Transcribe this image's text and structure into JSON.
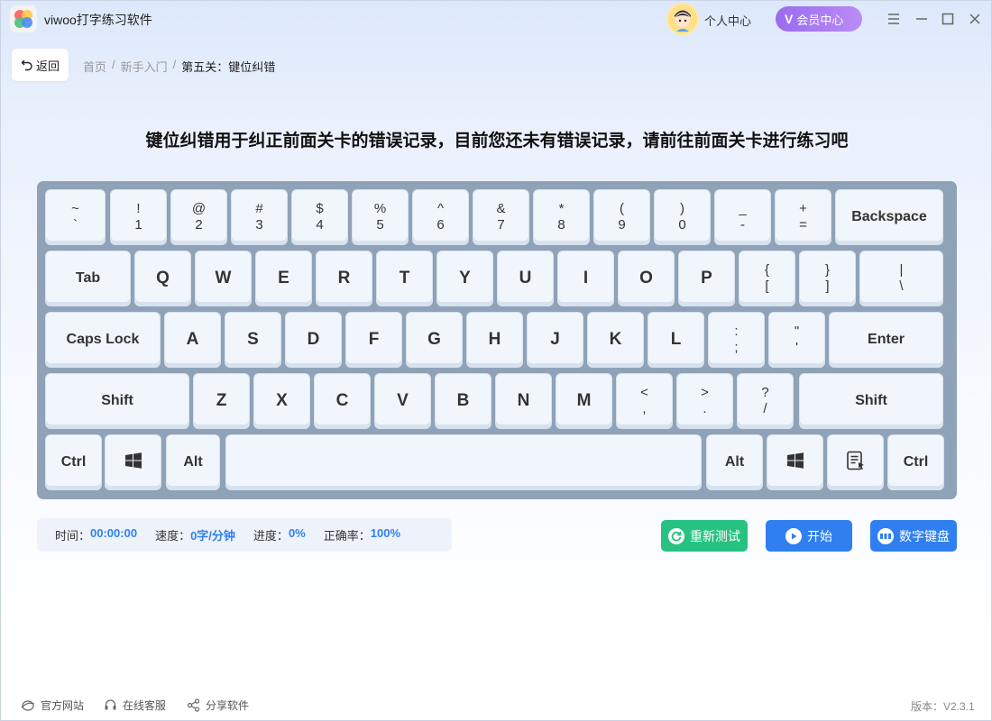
{
  "app": {
    "title": "viwoo打字练习软件",
    "user_center": "个人中心",
    "vip_label": "会员中心",
    "vip_badge": "V"
  },
  "nav": {
    "back_label": "返回",
    "breadcrumb": [
      "首页",
      "/",
      "新手入门",
      "/",
      "第五关：键位纠错"
    ]
  },
  "headline": "键位纠错用于纠正前面关卡的错误记录，目前您还未有错误记录，请前往前面关卡进行练习吧",
  "keyboard": {
    "row1": [
      {
        "top": "~",
        "bot": "`"
      },
      {
        "top": "!",
        "bot": "1"
      },
      {
        "top": "@",
        "bot": "2"
      },
      {
        "top": "#",
        "bot": "3"
      },
      {
        "top": "$",
        "bot": "4"
      },
      {
        "top": "%",
        "bot": "5"
      },
      {
        "top": "^",
        "bot": "6"
      },
      {
        "top": "&",
        "bot": "7"
      },
      {
        "top": "*",
        "bot": "8"
      },
      {
        "top": "(",
        "bot": "9"
      },
      {
        "top": ")",
        "bot": "0"
      },
      {
        "top": "_",
        "bot": "-"
      },
      {
        "top": "+",
        "bot": "="
      },
      {
        "lbl": "Backspace"
      }
    ],
    "row2": [
      {
        "lbl": "Tab"
      },
      {
        "lbl": "Q"
      },
      {
        "lbl": "W"
      },
      {
        "lbl": "E"
      },
      {
        "lbl": "R"
      },
      {
        "lbl": "T"
      },
      {
        "lbl": "Y"
      },
      {
        "lbl": "U"
      },
      {
        "lbl": "I"
      },
      {
        "lbl": "O"
      },
      {
        "lbl": "P"
      },
      {
        "top": "{",
        "bot": "["
      },
      {
        "top": "}",
        "bot": "]"
      },
      {
        "top": "|",
        "bot": "\\"
      }
    ],
    "row3": [
      {
        "lbl": "Caps Lock"
      },
      {
        "lbl": "A"
      },
      {
        "lbl": "S"
      },
      {
        "lbl": "D"
      },
      {
        "lbl": "F"
      },
      {
        "lbl": "G"
      },
      {
        "lbl": "H"
      },
      {
        "lbl": "J"
      },
      {
        "lbl": "K"
      },
      {
        "lbl": "L"
      },
      {
        "top": ":",
        "bot": ";"
      },
      {
        "top": "\"",
        "bot": "'"
      },
      {
        "lbl": "Enter"
      }
    ],
    "row4": [
      {
        "lbl": "Shift"
      },
      {
        "lbl": "Z"
      },
      {
        "lbl": "X"
      },
      {
        "lbl": "C"
      },
      {
        "lbl": "V"
      },
      {
        "lbl": "B"
      },
      {
        "lbl": "N"
      },
      {
        "lbl": "M"
      },
      {
        "top": "<",
        "bot": ","
      },
      {
        "top": ">",
        "bot": "."
      },
      {
        "top": "?",
        "bot": "/"
      },
      {
        "lbl": "Shift"
      }
    ],
    "row5": [
      {
        "lbl": "Ctrl"
      },
      {
        "icon": "windows-icon"
      },
      {
        "lbl": "Alt"
      },
      {
        "lbl": ""
      },
      {
        "lbl": "Alt"
      },
      {
        "icon": "windows-icon"
      },
      {
        "icon": "menu-key-icon"
      },
      {
        "lbl": "Ctrl"
      }
    ]
  },
  "stats": {
    "time_label": "时间：",
    "time_value": "00:00:00",
    "speed_label": "速度：",
    "speed_value": "0字/分钟",
    "progress_label": "进度：",
    "progress_value": "0%",
    "accuracy_label": "正确率：",
    "accuracy_value": "100%"
  },
  "actions": {
    "retest": "重新测试",
    "start": "开始",
    "numpad": "数字键盘"
  },
  "footer": {
    "website": "官方网站",
    "service": "在线客服",
    "share": "分享软件",
    "version": "版本：V2.3.1"
  },
  "colors": {
    "accent": "#2f7ff0",
    "green": "#27c281",
    "vip": "#9a6bf0",
    "keyboard_frame": "#8fa2b7"
  }
}
